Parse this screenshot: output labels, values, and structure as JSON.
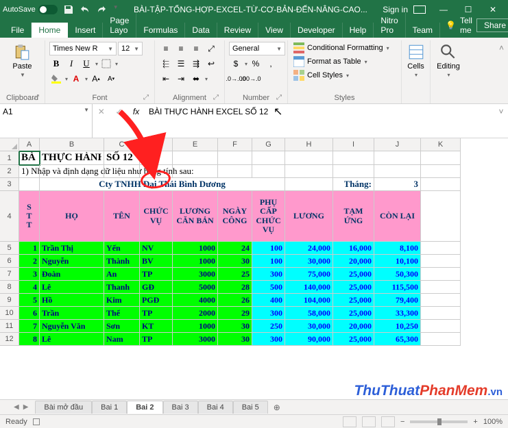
{
  "titlebar": {
    "autosave": "AutoSave",
    "title": "BÀI-TẬP-TỔNG-HỢP-EXCEL-TỪ-CƠ-BẢN-ĐẾN-NÂNG-CAO...",
    "signin": "Sign in"
  },
  "ribbon": {
    "tabs": [
      "File",
      "Home",
      "Insert",
      "Page Layo",
      "Formulas",
      "Data",
      "Review",
      "View",
      "Developer",
      "Help",
      "Nitro Pro",
      "Team"
    ],
    "tellme": "Tell me",
    "share": "Share"
  },
  "home": {
    "clipboard": {
      "label": "Clipboard",
      "paste": "Paste"
    },
    "font": {
      "label": "Font",
      "name": "Times New R",
      "size": "12",
      "bold": "B",
      "italic": "I",
      "under": "U"
    },
    "alignment": {
      "label": "Alignment"
    },
    "number": {
      "label": "Number",
      "format": "General"
    },
    "styles": {
      "label": "Styles",
      "condfmt": "Conditional Formatting",
      "table": "Format as Table",
      "cellstyles": "Cell Styles"
    },
    "cells": {
      "label": "Cells"
    },
    "editing": {
      "label": "Editing"
    }
  },
  "namebox": "A1",
  "fx": "fx",
  "formulabar": "BÀI THỰC HÀNH EXCEL SỐ 12",
  "cols": [
    "A",
    "B",
    "C",
    "D",
    "E",
    "F",
    "G",
    "H",
    "I",
    "J",
    "K"
  ],
  "row1_title": "BÀI THỰC HÀNH EXCEL SỐ 12",
  "row1_visA": "BÀ",
  "row2": "1) Nhập và định dạng dữ liệu như bảng tính sau:",
  "row3": {
    "company": "Cty TNHH Đại Thái Bình Dương",
    "month_lbl": "Tháng:",
    "month": "3"
  },
  "headers": [
    "S\nT\nT",
    "HỌ",
    "TÊN",
    "CHỨC VỤ",
    "LƯƠNG CĂN BẢN",
    "NGÀY CÔNG",
    "PHỤ CẤP CHỨC VỤ",
    "LƯƠNG",
    "TẠM ỨNG",
    "CÒN LẠI"
  ],
  "rows": [
    {
      "stt": "1",
      "ho": "Trần Thị",
      "ten": "Yến",
      "cv": "NV",
      "lcb": "1000",
      "nc": "24",
      "pc": "100",
      "luong": "24,000",
      "tu": "16,000",
      "cl": "8,100"
    },
    {
      "stt": "2",
      "ho": "Nguyễn",
      "ten": "Thành",
      "cv": "BV",
      "lcb": "1000",
      "nc": "30",
      "pc": "100",
      "luong": "30,000",
      "tu": "20,000",
      "cl": "10,100"
    },
    {
      "stt": "3",
      "ho": "Đoàn",
      "ten": "An",
      "cv": "TP",
      "lcb": "3000",
      "nc": "25",
      "pc": "300",
      "luong": "75,000",
      "tu": "25,000",
      "cl": "50,300"
    },
    {
      "stt": "4",
      "ho": "Lê",
      "ten": "Thanh",
      "cv": "GĐ",
      "lcb": "5000",
      "nc": "28",
      "pc": "500",
      "luong": "140,000",
      "tu": "25,000",
      "cl": "115,500"
    },
    {
      "stt": "5",
      "ho": "Hồ",
      "ten": "Kim",
      "cv": "PGĐ",
      "lcb": "4000",
      "nc": "26",
      "pc": "400",
      "luong": "104,000",
      "tu": "25,000",
      "cl": "79,400"
    },
    {
      "stt": "6",
      "ho": "Trần",
      "ten": "Thế",
      "cv": "TP",
      "lcb": "2000",
      "nc": "29",
      "pc": "300",
      "luong": "58,000",
      "tu": "25,000",
      "cl": "33,300"
    },
    {
      "stt": "7",
      "ho": "Nguyễn Văn",
      "ten": "Sơn",
      "cv": "KT",
      "lcb": "1000",
      "nc": "30",
      "pc": "250",
      "luong": "30,000",
      "tu": "20,000",
      "cl": "10,250"
    },
    {
      "stt": "8",
      "ho": "Lê",
      "ten": "Nam",
      "cv": "TP",
      "lcb": "3000",
      "nc": "30",
      "pc": "300",
      "luong": "90,000",
      "tu": "25,000",
      "cl": "65,300"
    }
  ],
  "rowlabels": [
    "1",
    "2",
    "3",
    "4",
    "5",
    "6",
    "7",
    "8",
    "9",
    "10",
    "11",
    "12"
  ],
  "sheets": [
    "Bài mở đầu",
    "Bai 1",
    "Bai 2",
    "Bai 3",
    "Bai 4",
    "Bai 5"
  ],
  "active_sheet": 2,
  "status": {
    "ready": "Ready",
    "zoom": "100%"
  },
  "watermark": {
    "a": "ThuThuat",
    "b": "PhanMem",
    "c": ".vn"
  }
}
